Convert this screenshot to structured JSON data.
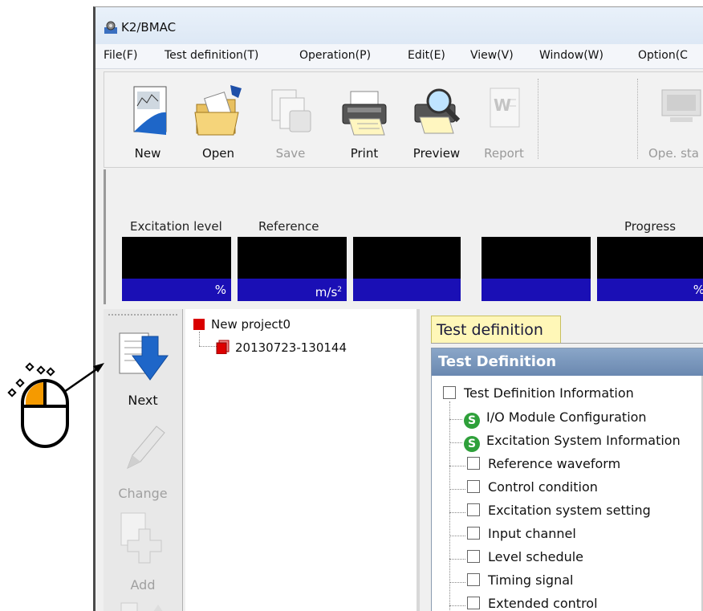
{
  "window": {
    "title": "K2/BMAC"
  },
  "menu": [
    {
      "label": "File(F)"
    },
    {
      "label": "Test definition(T)"
    },
    {
      "label": "Operation(P)"
    },
    {
      "label": "Edit(E)"
    },
    {
      "label": "View(V)"
    },
    {
      "label": "Window(W)"
    },
    {
      "label": "Option(C"
    }
  ],
  "toolbar": {
    "new_label": "New",
    "open_label": "Open",
    "save_label": "Save",
    "print_label": "Print",
    "preview_label": "Preview",
    "report_label": "Report",
    "opestart_label": "Ope. sta"
  },
  "status": {
    "excitation_header": "Excitation level",
    "reference_header": "Reference",
    "progress_header": "Progress",
    "unit_percent": "%",
    "unit_ms2": "m/s",
    "unit_ms2_sup": "2",
    "unit_progress": "%"
  },
  "side_buttons": {
    "next_label": "Next",
    "change_label": "Change",
    "add_label": "Add"
  },
  "tree": {
    "project": "New project0",
    "test": "20130723-130144"
  },
  "doc": {
    "tab_label": "Test definition",
    "panel_header": "Test Definition",
    "root": "Test Definition Information",
    "items": [
      "I/O Module Configuration",
      "Excitation System Information",
      "Reference waveform",
      "Control condition",
      "Excitation system setting",
      "Input channel",
      "Level schedule",
      "Timing signal",
      "Extended control"
    ],
    "status_icon_letter": "S"
  },
  "colors": {
    "meter_screen": "#000000",
    "meter_unit": "#1a0fb5",
    "accent_red": "#d90000",
    "tab_yellow": "#fff7b8",
    "status_green": "#2ea03a",
    "mouse_orange": "#f59a00"
  }
}
